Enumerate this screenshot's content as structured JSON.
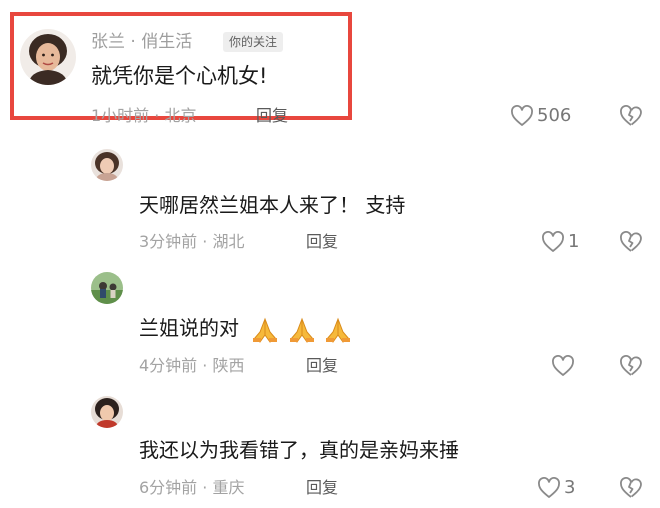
{
  "comments": [
    {
      "author": "张兰 · 俏生活",
      "badge": "你的关注",
      "text": "就凭你是个心机女!",
      "meta": "1小时前 · 北京",
      "reply_label": "回复",
      "likes": "506",
      "highlighted": true
    },
    {
      "text": "天哪居然兰姐本人来了！ 支持",
      "meta": "3分钟前 · 湖北",
      "reply_label": "回复",
      "likes": "1"
    },
    {
      "text": "兰姐说的对",
      "emoji": [
        "folded-hands-icon",
        "folded-hands-icon",
        "folded-hands-icon"
      ],
      "meta": "4分钟前 · 陕西",
      "reply_label": "回复",
      "likes": ""
    },
    {
      "text": "我还以为我看错了，真的是亲妈来捶",
      "meta": "6分钟前 · 重庆",
      "reply_label": "回复",
      "likes": "3"
    }
  ],
  "colors": {
    "highlight_border": "#e8473e",
    "meta_text": "#a3a3a3",
    "body_text": "#1a1a1a",
    "icon_gray": "#8a8a8a"
  }
}
